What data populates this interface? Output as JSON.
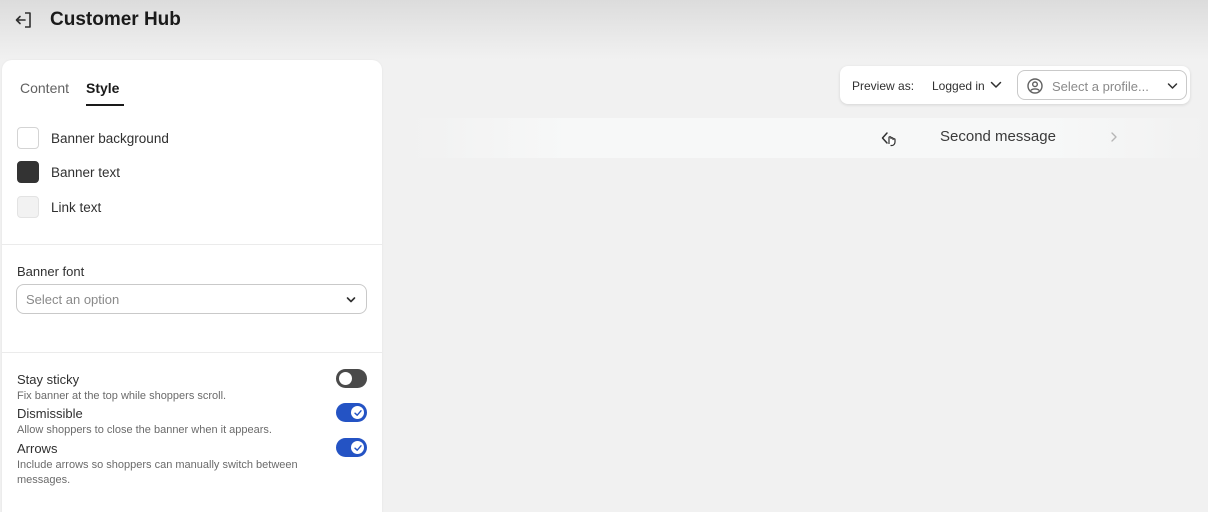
{
  "header": {
    "title": "Customer Hub"
  },
  "tabs": [
    {
      "label": "Content",
      "active": false
    },
    {
      "label": "Style",
      "active": true
    }
  ],
  "colors": [
    {
      "label": "Banner background",
      "value": "#ffffff"
    },
    {
      "label": "Banner text",
      "value": "#333333"
    },
    {
      "label": "Link text",
      "value": "#f2f2f2"
    }
  ],
  "font": {
    "label": "Banner font",
    "placeholder": "Select an option"
  },
  "toggles": [
    {
      "title": "Stay sticky",
      "description": "Fix banner at the top while shoppers scroll.",
      "enabled": false
    },
    {
      "title": "Dismissible",
      "description": "Allow shoppers to close the banner when it appears.",
      "enabled": true
    },
    {
      "title": "Arrows",
      "description": "Include arrows so shoppers can manually switch between messages.",
      "enabled": true
    }
  ],
  "preview": {
    "label": "Preview as:",
    "mode": "Logged in",
    "profile_placeholder": "Select a profile..."
  },
  "banner": {
    "message": "Second message"
  },
  "accent_color": "#2453c4"
}
